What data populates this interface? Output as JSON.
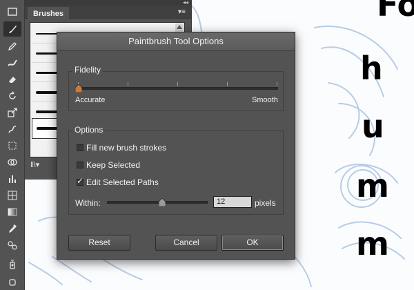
{
  "canvas": {
    "letters": [
      "Fo",
      "h",
      "u",
      "m",
      "m"
    ]
  },
  "toolbar": {
    "tools": [
      "selection-tool",
      "paintbrush-tool",
      "pencil-tool",
      "blob-brush-tool",
      "eraser-tool",
      "rotate-tool",
      "scale-tool",
      "warp-tool",
      "free-transform-tool",
      "shape-builder-tool",
      "column-graph-tool",
      "mesh-tool",
      "gradient-tool",
      "eyedropper-tool",
      "blend-tool",
      "symbol-sprayer-tool"
    ],
    "active": "paintbrush-tool"
  },
  "brushes_panel": {
    "tab_label": "Brushes",
    "collapse_glyph": "◂◂",
    "menu_glyph": "▾≡",
    "library_glyph": "ǁ\\▾",
    "rows": [
      {
        "name": "brush-1",
        "selected": false
      },
      {
        "name": "brush-2",
        "selected": false
      },
      {
        "name": "brush-3",
        "selected": false
      },
      {
        "name": "brush-4",
        "selected": false
      },
      {
        "name": "brush-5",
        "selected": false
      },
      {
        "name": "brush-6",
        "selected": true
      }
    ]
  },
  "dialog": {
    "title": "Paintbrush Tool Options",
    "fidelity": {
      "group_label": "Fidelity",
      "min_label": "Accurate",
      "max_label": "Smooth",
      "value_fraction": 0.0,
      "tick_count": 5
    },
    "options": {
      "group_label": "Options",
      "checkboxes": [
        {
          "label": "Fill new brush strokes",
          "checked": false
        },
        {
          "label": "Keep Selected",
          "checked": false
        },
        {
          "label": "Edit Selected Paths",
          "checked": true
        }
      ],
      "within": {
        "label": "Within:",
        "value": "12",
        "unit": "pixels",
        "slider_fraction": 0.55
      }
    },
    "buttons": {
      "reset": "Reset",
      "cancel": "Cancel",
      "ok": "OK"
    }
  },
  "colors": {
    "panel": "#535353",
    "toolbar": "#535353",
    "canvas_sketch": "#b7cce6",
    "canvas_bg": "#fbfcfe"
  }
}
